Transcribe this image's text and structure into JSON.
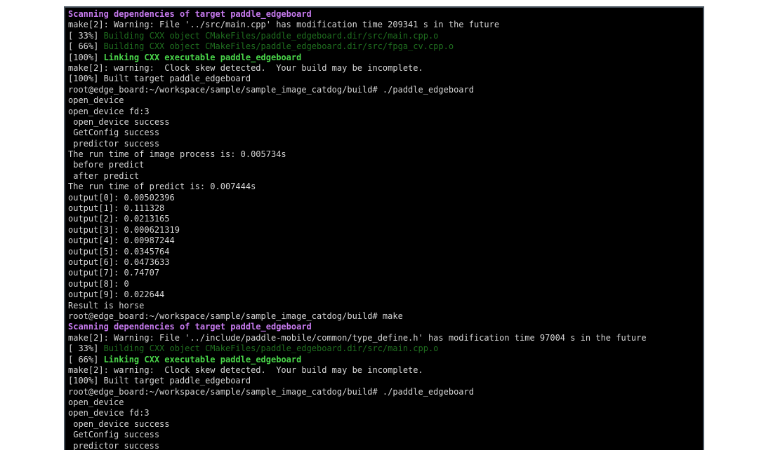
{
  "colors": {
    "background": "#000000",
    "frame": "#4a5560",
    "default_text": "#d6d6d6",
    "magenta": "#c87bf0",
    "green_bold": "#4ad64a",
    "green_dim": "#1f6e1f"
  },
  "terminal": {
    "lines": [
      [
        {
          "t": "Scanning dependencies of target paddle_edgeboard",
          "s": "magenta"
        }
      ],
      [
        {
          "t": "make[2]: Warning: File '../src/main.cpp' has modification time 209341 s in the future",
          "s": "default"
        }
      ],
      [
        {
          "t": "[ 33%] ",
          "s": "default"
        },
        {
          "t": "Building CXX object CMakeFiles/paddle_edgeboard.dir/src/main.cpp.o",
          "s": "green-dim"
        }
      ],
      [
        {
          "t": "[ 66%] ",
          "s": "default"
        },
        {
          "t": "Building CXX object CMakeFiles/paddle_edgeboard.dir/src/fpga_cv.cpp.o",
          "s": "green-dim"
        }
      ],
      [
        {
          "t": "[100%] ",
          "s": "default"
        },
        {
          "t": "Linking CXX executable paddle_edgeboard",
          "s": "green-bold"
        }
      ],
      [
        {
          "t": "make[2]: warning:  Clock skew detected.  Your build may be incomplete.",
          "s": "default"
        }
      ],
      [
        {
          "t": "[100%] Built target paddle_edgeboard",
          "s": "default"
        }
      ],
      [
        {
          "t": "root@edge_board:~/workspace/sample/sample_image_catdog/build# ./paddle_edgeboard",
          "s": "default"
        }
      ],
      [
        {
          "t": "open_device",
          "s": "default"
        }
      ],
      [
        {
          "t": "open_device fd:3",
          "s": "default"
        }
      ],
      [
        {
          "t": " open_device success",
          "s": "default"
        }
      ],
      [
        {
          "t": " GetConfig success",
          "s": "default"
        }
      ],
      [
        {
          "t": " predictor success",
          "s": "default"
        }
      ],
      [
        {
          "t": "The run time of image process is: 0.005734s",
          "s": "default"
        }
      ],
      [
        {
          "t": " before predict",
          "s": "default"
        }
      ],
      [
        {
          "t": " after predict",
          "s": "default"
        }
      ],
      [
        {
          "t": "The run time of predict is: 0.007444s",
          "s": "default"
        }
      ],
      [
        {
          "t": "output[0]: 0.00502396",
          "s": "default"
        }
      ],
      [
        {
          "t": "output[1]: 0.111328",
          "s": "default"
        }
      ],
      [
        {
          "t": "output[2]: 0.0213165",
          "s": "default"
        }
      ],
      [
        {
          "t": "output[3]: 0.000621319",
          "s": "default"
        }
      ],
      [
        {
          "t": "output[4]: 0.00987244",
          "s": "default"
        }
      ],
      [
        {
          "t": "output[5]: 0.0345764",
          "s": "default"
        }
      ],
      [
        {
          "t": "output[6]: 0.0473633",
          "s": "default"
        }
      ],
      [
        {
          "t": "output[7]: 0.74707",
          "s": "default"
        }
      ],
      [
        {
          "t": "output[8]: 0",
          "s": "default"
        }
      ],
      [
        {
          "t": "output[9]: 0.022644",
          "s": "default"
        }
      ],
      [
        {
          "t": "Result is horse",
          "s": "default"
        }
      ],
      [
        {
          "t": "root@edge_board:~/workspace/sample/sample_image_catdog/build# make",
          "s": "default"
        }
      ],
      [
        {
          "t": "Scanning dependencies of target paddle_edgeboard",
          "s": "magenta"
        }
      ],
      [
        {
          "t": "make[2]: Warning: File '../include/paddle-mobile/common/type_define.h' has modification time 97004 s in the future",
          "s": "default"
        }
      ],
      [
        {
          "t": "[ 33%] ",
          "s": "default"
        },
        {
          "t": "Building CXX object CMakeFiles/paddle_edgeboard.dir/src/main.cpp.o",
          "s": "green-dim"
        }
      ],
      [
        {
          "t": "[ 66%] ",
          "s": "default"
        },
        {
          "t": "Linking CXX executable paddle_edgeboard",
          "s": "green-bold"
        }
      ],
      [
        {
          "t": "make[2]: warning:  Clock skew detected.  Your build may be incomplete.",
          "s": "default"
        }
      ],
      [
        {
          "t": "[100%] Built target paddle_edgeboard",
          "s": "default"
        }
      ],
      [
        {
          "t": "root@edge_board:~/workspace/sample/sample_image_catdog/build# ./paddle_edgeboard",
          "s": "default"
        }
      ],
      [
        {
          "t": "open_device",
          "s": "default"
        }
      ],
      [
        {
          "t": "open_device fd:3",
          "s": "default"
        }
      ],
      [
        {
          "t": " open_device success",
          "s": "default"
        }
      ],
      [
        {
          "t": " GetConfig success",
          "s": "default"
        }
      ],
      [
        {
          "t": " predictor success",
          "s": "default"
        }
      ]
    ]
  }
}
